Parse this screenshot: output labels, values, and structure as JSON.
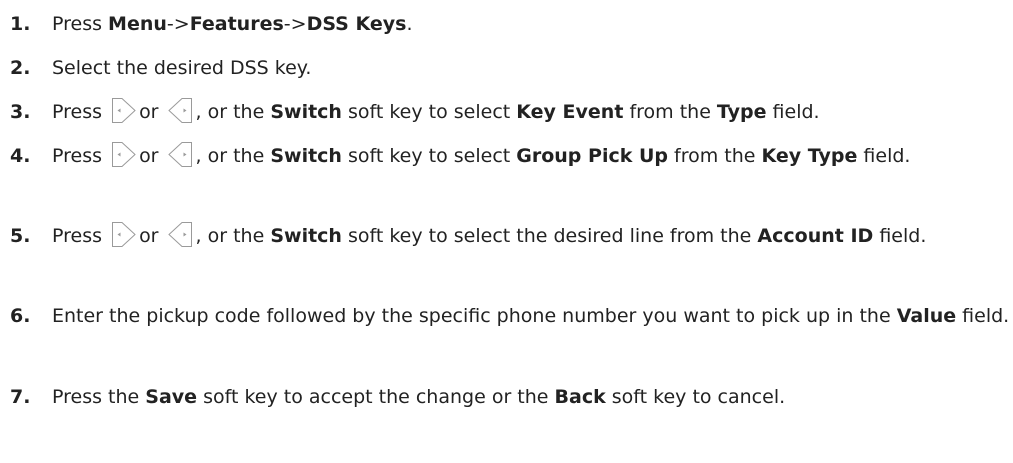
{
  "steps": [
    {
      "num": "1.",
      "parts": [
        "Press ",
        "Menu",
        "->",
        "Features",
        "->",
        "DSS Keys",
        "."
      ]
    },
    {
      "num": "2.",
      "text": "Select the desired DSS key."
    },
    {
      "num": "3.",
      "press": "Press",
      "or": "or",
      "parts": [
        ", or the ",
        "Switch",
        " soft key to select ",
        "Key Event",
        " from the ",
        "Type",
        " field."
      ]
    },
    {
      "num": "4.",
      "press": "Press",
      "or": "or",
      "parts": [
        ", or the ",
        "Switch",
        " soft key to select ",
        "Group Pick Up",
        " from the ",
        "Key Type",
        " field."
      ]
    },
    {
      "num": "5.",
      "press": "Press",
      "or": "or",
      "parts": [
        ", or the ",
        "Switch",
        " soft key to select the desired line from the ",
        "Account ID",
        " field."
      ]
    },
    {
      "num": "6.",
      "parts": [
        "Enter the pickup code followed by the specific phone number you want to pick up in the ",
        "Value",
        " field."
      ]
    },
    {
      "num": "7.",
      "parts": [
        "Press the ",
        "Save",
        " soft key to accept the change or the ",
        "Back",
        " soft key to cancel."
      ]
    }
  ],
  "icons": {
    "right": "right-navigation-key-icon",
    "left": "left-navigation-key-icon"
  }
}
